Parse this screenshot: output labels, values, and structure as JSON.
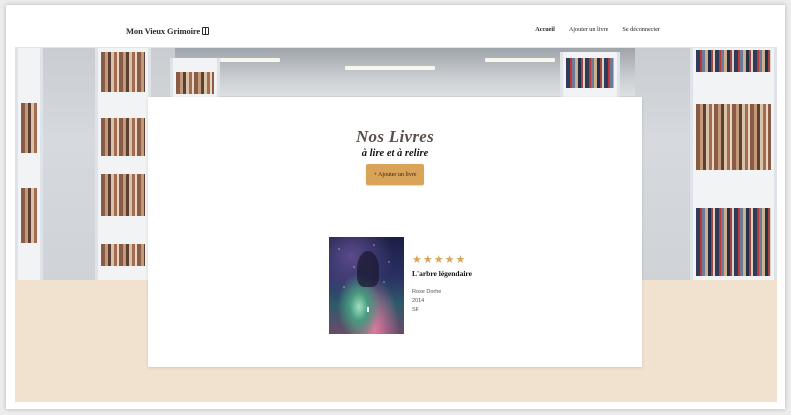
{
  "header": {
    "brand": "Mon Vieux Grimoire",
    "nav": [
      {
        "label": "Accueil",
        "active": true
      },
      {
        "label": "Ajouter un livre",
        "active": false
      },
      {
        "label": "Se déconnecter",
        "active": false
      }
    ]
  },
  "main": {
    "title": "Nos Livres",
    "subtitle": "à lire et à relire",
    "add_button": "+ Ajouter un livre"
  },
  "books": [
    {
      "title": "L'arbre légendaire",
      "author": "Rose Dorhe",
      "year": "2014",
      "genre": "SF",
      "rating": 5
    }
  ],
  "colors": {
    "accent": "#d9a45a",
    "footer_bg": "#f1e2cf"
  }
}
